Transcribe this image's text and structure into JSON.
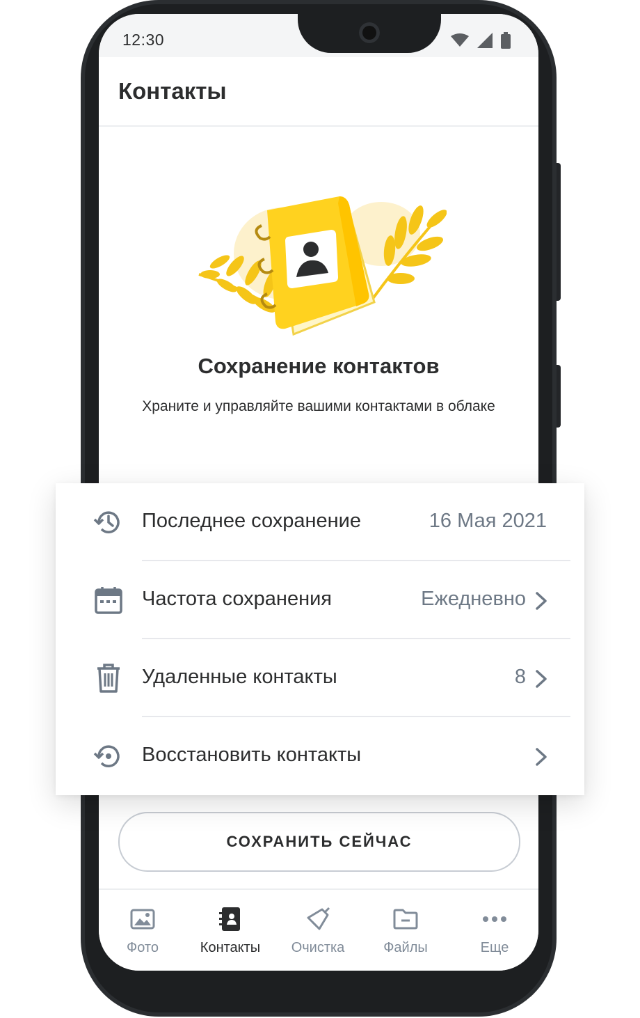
{
  "status_bar": {
    "time": "12:30"
  },
  "header": {
    "title": "Контакты"
  },
  "hero": {
    "title": "Сохранение контактов",
    "subtitle": "Храните и управляйте вашими контактами в облаке"
  },
  "settings": {
    "rows": [
      {
        "label": "Последнее сохранение",
        "value": "16 Мая 2021",
        "icon": "history-icon",
        "has_chevron": false
      },
      {
        "label": "Частота сохранения",
        "value": "Ежедневно",
        "icon": "calendar-icon",
        "has_chevron": true
      },
      {
        "label": "Удаленные контакты",
        "value": "8",
        "icon": "trash-icon",
        "has_chevron": true
      },
      {
        "label": "Восстановить контакты",
        "value": "",
        "icon": "restore-icon",
        "has_chevron": true
      }
    ]
  },
  "actions": {
    "save_now": "СОХРАНИТЬ СЕЙЧАС"
  },
  "bottom_nav": {
    "items": [
      {
        "label": "Фото",
        "icon": "photo-icon",
        "active": false
      },
      {
        "label": "Контакты",
        "icon": "contacts-book-icon",
        "active": true
      },
      {
        "label": "Очистка",
        "icon": "broom-icon",
        "active": false
      },
      {
        "label": "Файлы",
        "icon": "folder-icon",
        "active": false
      },
      {
        "label": "Еще",
        "icon": "more-dots-icon",
        "active": false
      }
    ]
  },
  "colors": {
    "text_primary": "#2c2d2e",
    "text_secondary": "#6d7885",
    "icon_gray": "#818c99",
    "accent_yellow": "#ffd21f",
    "phone_frame": "#1d1f21"
  }
}
